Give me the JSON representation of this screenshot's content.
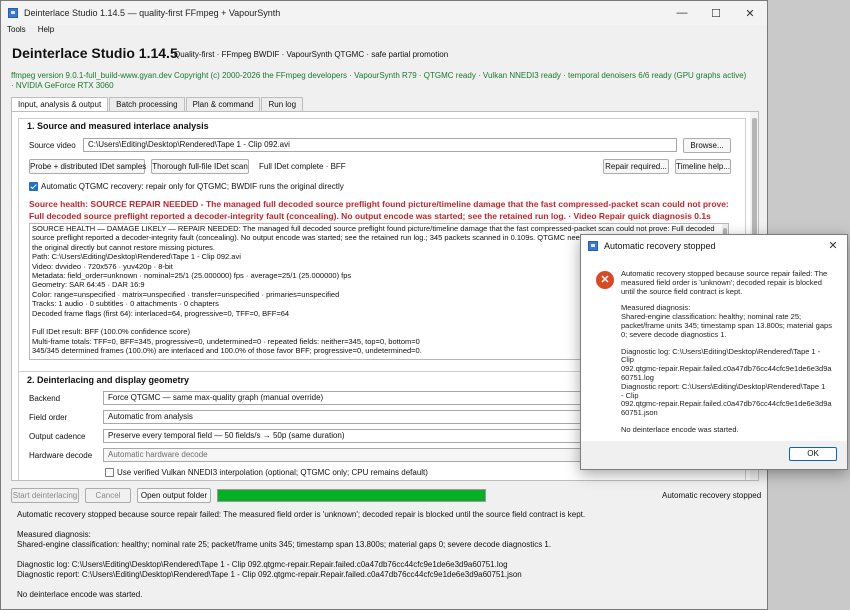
{
  "window": {
    "title": "Deinterlace Studio 1.14.5 — quality-first FFmpeg + VapourSynth",
    "controls": [
      "—",
      "☐",
      "✕"
    ]
  },
  "menu": [
    "Tools",
    "Help"
  ],
  "header": {
    "app_title": "Deinterlace Studio 1.14.5",
    "tagline": "Quality-first · FFmpeg BWDIF · VapourSynth QTGMC · safe partial promotion",
    "version_line": "ffmpeg version 9.0.1-full_build-www.gyan.dev Copyright (c) 2000-2026 the FFmpeg developers · VapourSynth R79 · QTGMC ready · Vulkan NNEDI3 ready · temporal denoisers 6/6 ready (GPU graphs active) · NVIDIA GeForce RTX 3060"
  },
  "tabs": [
    "Input, analysis & output",
    "Batch processing",
    "Plan & command",
    "Run log"
  ],
  "section1": {
    "title": "1. Source and measured interlace analysis",
    "source_label": "Source video",
    "source_value": "C:\\Users\\Editing\\Desktop\\Rendered\\Tape 1 - Clip 092.avi",
    "browse": "Browse...",
    "probe_btn": "Probe + distributed IDet samples",
    "thorough_btn": "Thorough full-file IDet scan",
    "idet_status": "Full IDet complete · BFF",
    "repair_btn": "Repair required...",
    "timeline_btn": "Timeline help...",
    "auto_check_label": "Automatic QTGMC recovery: repair only for QTGMC; BWDIF runs the original directly",
    "auto_checked": true,
    "health_line1": "Source health: SOURCE REPAIR NEEDED - The managed full decoded source preflight found picture/timeline damage that the fast compressed-packet scan could not prove:",
    "health_line2": "Full decoded source preflight reported a decoder-integrity fault (concealing). No output encode was started; see the retained run log. · Video Repair quick diagnosis 0.1s",
    "log_lines": [
      "SOURCE HEALTH — DAMAGE LIKELY — REPAIR NEEDED: The managed full decoded source preflight found picture/timeline damage that the fast compressed-packet scan could not prove: Full decoded",
      "source preflight reported a decoder-integrity fault (concealing). No output encode was started; see the retained run log.; 345 packets scanned in 0.109s. QTGMC needs repair; BWDIF uses",
      "the original directly but cannot restore missing pictures.",
      "Path: C:\\Users\\Editing\\Desktop\\Rendered\\Tape 1 - Clip 092.avi",
      "Video: dvvideo · 720x576 · yuv420p · 8-bit",
      "Metadata: field_order=unknown · nominal=25/1 (25.000000) fps · average=25/1 (25.000000) fps",
      "Geometry: SAR 64:45 · DAR 16:9",
      "Color: range=unspecified · matrix=unspecified · transfer=unspecified · primaries=unspecified",
      "Tracks: 1 audio · 0 subtitles · 0 attachments · 0 chapters",
      "Decoded frame flags (first 64): interlaced=64, progressive=0, TFF=0, BFF=64",
      "",
      "Full IDet result: BFF (100.0% confidence score)",
      "Multi-frame totals: TFF=0, BFF=345, progressive=0, undetermined=0 · repeated fields: neither=345, top=0, bottom=0",
      "345/345 determined frames (100.0%) are interlaced and 100.0% of those favor BFF; progressive=0, undetermined=0."
    ]
  },
  "section2": {
    "title": "2. Deinterlacing and display geometry",
    "backend_label": "Backend",
    "backend_value": "Force QTGMC — same max-quality graph (manual override)",
    "field_order_label": "Field order",
    "field_order_value": "Automatic from analysis",
    "cadence_label": "Output cadence",
    "cadence_value": "Preserve every temporal field — 50 fields/s → 50p (same duration)",
    "hw_label": "Hardware decode",
    "hw_value": "Automatic hardware decode",
    "vulkan_label": "Use verified Vulkan NNEDI3 interpolation (optional; QTGMC only; CPU remains default)",
    "vulkan_checked": false
  },
  "bottom": {
    "start_btn": "Start deinterlacing",
    "cancel_btn": "Cancel",
    "open_btn": "Open output folder",
    "progress": 1.0,
    "status": "Automatic recovery stopped",
    "message_lines": [
      "Automatic recovery stopped because source repair failed: The measured field order is 'unknown'; decoded repair is blocked until the source field contract is kept.",
      "",
      "Measured diagnosis:",
      "Shared-engine classification: healthy; nominal rate 25; packet/frame units 345; timestamp span 13.800s; material gaps 0; severe decode diagnostics 1.",
      "",
      "Diagnostic log: C:\\Users\\Editing\\Desktop\\Rendered\\Tape 1 - Clip 092.qtgmc-repair.Repair.failed.c0a47db76cc44cfc9e1de6e3d9a60751.log",
      "Diagnostic report: C:\\Users\\Editing\\Desktop\\Rendered\\Tape 1 - Clip 092.qtgmc-repair.Repair.failed.c0a47db76cc44cfc9e1de6e3d9a60751.json",
      "",
      "No deinterlace encode was started."
    ]
  },
  "dialog": {
    "title": "Automatic recovery stopped",
    "close": "✕",
    "paragraphs": [
      [
        "Automatic recovery stopped because source repair failed: The",
        "measured field order is 'unknown'; decoded repair is blocked",
        "until the source field contract is kept."
      ],
      [
        "Measured diagnosis:",
        "Shared-engine classification: healthy; nominal rate 25;",
        "packet/frame units 345; timestamp span 13.800s; material gaps",
        "0; severe decode diagnostics 1."
      ],
      [
        "Diagnostic log: C:\\Users\\Editing\\Desktop\\Rendered\\Tape 1 - Clip",
        "092.qtgmc-repair.Repair.failed.c0a47db76cc44cfc9e1de6e3d9a",
        "60751.log",
        "Diagnostic report: C:\\Users\\Editing\\Desktop\\Rendered\\Tape 1",
        "- Clip",
        "092.qtgmc-repair.Repair.failed.c0a47db76cc44cfc9e1de6e3d9a",
        "60751.json"
      ],
      [
        "No deinterlace encode was started."
      ]
    ],
    "ok": "OK"
  }
}
